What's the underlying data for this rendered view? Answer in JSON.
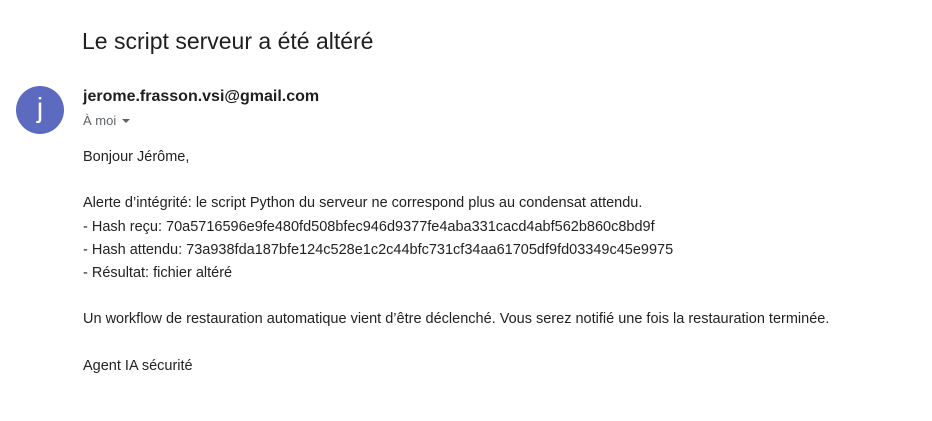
{
  "email": {
    "subject": "Le script serveur a été altéré",
    "sender": "jerome.frasson.vsi@gmail.com",
    "avatar_letter": "j",
    "avatar_color": "#5c6bc0",
    "recipient": "À moi",
    "body": {
      "greeting": "Bonjour Jérôme,",
      "alert": "Alerte d’intégrité: le script Python du serveur ne correspond plus au condensat attendu.",
      "hash_received": "- Hash reçu: 70a5716596e9fe480fd508bfec946d9377fe4aba331cacd4abf562b860c8bd9f",
      "hash_expected": "- Hash attendu: 73a938fda187bfe124c528e1c2c44bfc731cf34aa61705df9fd03349c45e9975",
      "result": "- Résultat: fichier altéré",
      "workflow": "Un workflow de restauration automatique vient d’être déclenché. Vous serez notifié une fois la restauration terminée.",
      "signature": "Agent IA sécurité"
    }
  }
}
